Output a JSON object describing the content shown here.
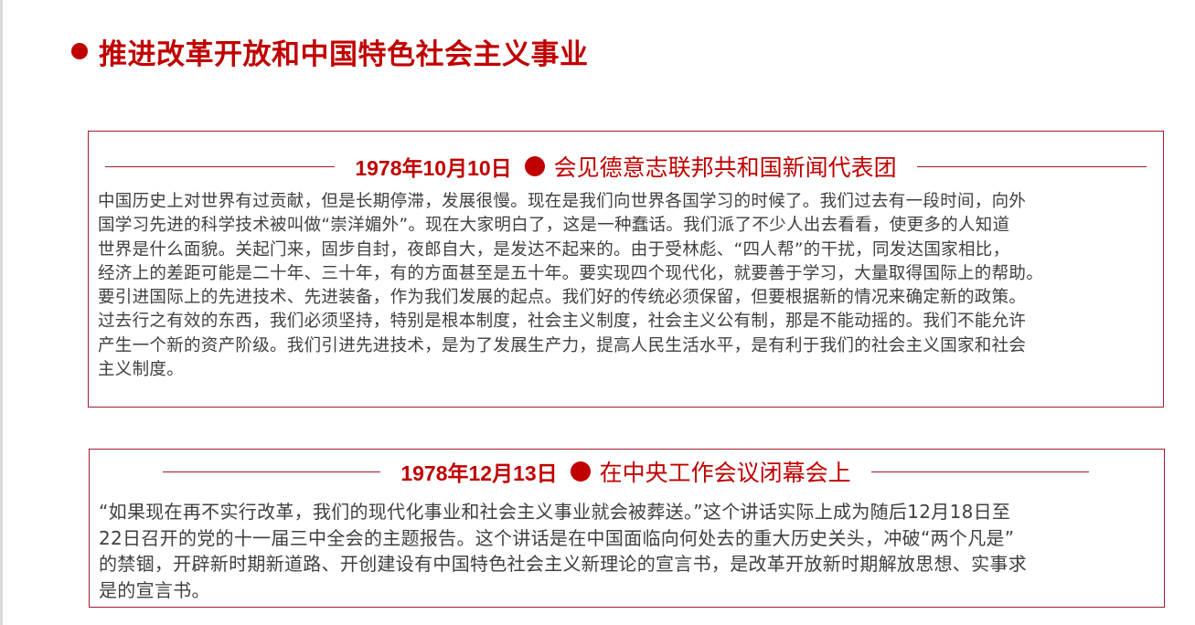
{
  "page": {
    "title": "推进改革开放和中国特色社会主义事业"
  },
  "colors": {
    "accent": "#c00000",
    "border": "#a11d2b",
    "body_text": "#404040"
  },
  "cards": [
    {
      "date": "1978年10月10日",
      "event": "会见德意志联邦共和国新闻代表团",
      "body": "中国历史上对世界有过贡献，但是长期停滞，发展很慢。现在是我们向世界各国学习的时候了。我们过去有一段时间，向外\n国学习先进的科学技术被叫做“崇洋媚外”。现在大家明白了，这是一种蠢话。我们派了不少人出去看看，使更多的人知道\n世界是什么面貌。关起门来，固步自封，夜郎自大，是发达不起来的。由于受林彪、“四人帮”的干扰，同发达国家相比，\n经济上的差距可能是二十年、三十年，有的方面甚至是五十年。要实现四个现代化，就要善于学习，大量取得国际上的帮助。\n要引进国际上的先进技术、先进装备，作为我们发展的起点。我们好的传统必须保留，但要根据新的情况来确定新的政策。\n过去行之有效的东西，我们必须坚持，特别是根本制度，社会主义制度，社会主义公有制，那是不能动摇的。我们不能允许\n产生一个新的资产阶级。我们引进先进技术，是为了发展生产力，提高人民生活水平，是有利于我们的社会主义国家和社会\n主义制度。"
    },
    {
      "date": "1978年12月13日",
      "event": "在中央工作会议闭幕会上",
      "body": "“如果现在再不实行改革，我们的现代化事业和社会主义事业就会被葬送。”这个讲话实际上成为随后12月18日至\n22日召开的党的十一届三中全会的主题报告。这个讲话是在中国面临向何处去的重大历史关头，冲破“两个凡是”\n的禁锢，开辟新时期新道路、开创建设有中国特色社会主义新理论的宣言书，是改革开放新时期解放思想、实事求\n是的宣言书。"
    }
  ]
}
